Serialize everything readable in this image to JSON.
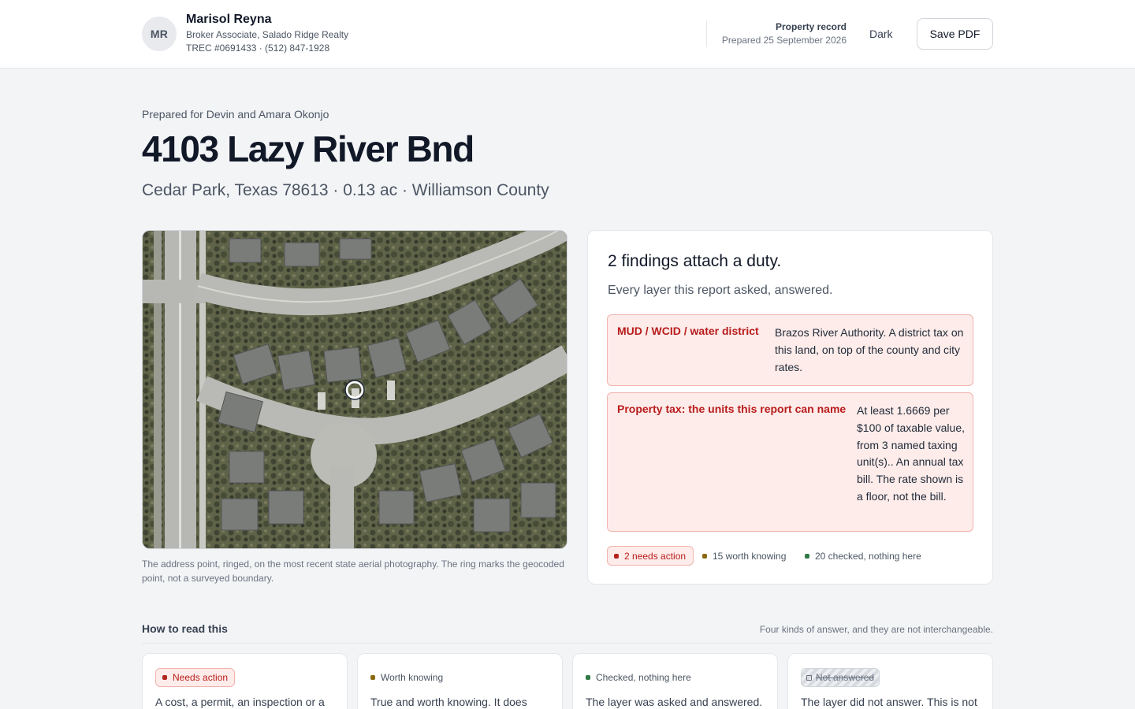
{
  "agent": {
    "initials": "MR",
    "name": "Marisol Reyna",
    "role": "Broker Associate, Salado Ridge Realty",
    "license": "TREC #0691433 · (512) 847-1928"
  },
  "record": {
    "title": "Property record",
    "prepared": "Prepared 25 September 2026"
  },
  "toolbar": {
    "dark_label": "Dark",
    "save_pdf_label": "Save PDF"
  },
  "property": {
    "prepared_for": "Prepared for Devin and Amara Okonjo",
    "address": "4103 Lazy River Bnd",
    "location": "Cedar Park, Texas 78613 · 0.13 ac · Williamson County"
  },
  "aerial": {
    "caption": "The address point, ringed, on the most recent state aerial photography. The ring marks the geocoded point, not a surveyed boundary."
  },
  "findings": {
    "title": "2 findings attach a duty.",
    "subtitle": "Every layer this report asked, answered.",
    "items": [
      {
        "label": "MUD / WCID / water district",
        "text": "Brazos River Authority. A district tax on this land, on top of the county and city rates."
      },
      {
        "label": "Property tax: the units this report can name",
        "text": "At least 1.6669 per $100 of taxable value, from 3 named taxing unit(s).. An annual tax bill. The rate shown is a floor, not the bill."
      }
    ],
    "summary": {
      "needs_action": "2 needs action",
      "worth_knowing": "15 worth knowing",
      "checked": "20 checked, nothing here"
    }
  },
  "howto": {
    "title": "How to read this",
    "note": "Four kinds of answer, and they are not interchangeable.",
    "cards": [
      {
        "chip": "Needs action",
        "text": "A cost, a permit, an inspection or a"
      },
      {
        "chip": "Worth knowing",
        "text": "True and worth knowing. It does"
      },
      {
        "chip": "Checked, nothing here",
        "text": "The layer was asked and answered."
      },
      {
        "chip": "Not answered",
        "text": "The layer did not answer. This is not"
      }
    ]
  },
  "colors": {
    "needs_action": "#b3261e",
    "worth_knowing": "#8a6a12",
    "checked": "#2f7a46",
    "finding_bg": "#fdecea"
  }
}
